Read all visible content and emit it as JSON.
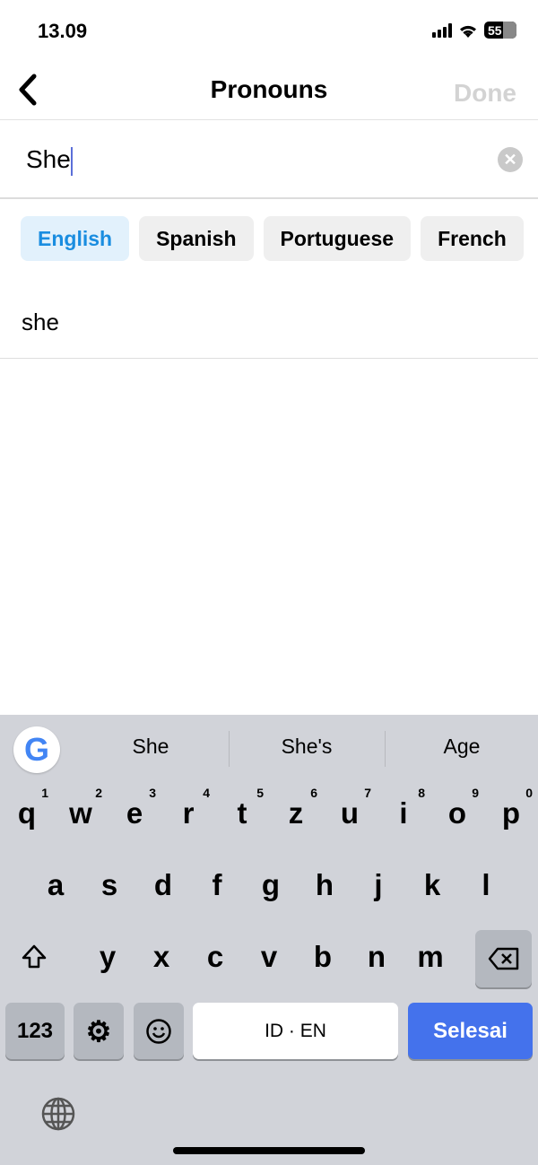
{
  "status": {
    "time": "13.09",
    "battery": "55"
  },
  "nav": {
    "title": "Pronouns",
    "done_label": "Done"
  },
  "search": {
    "value": "She"
  },
  "chips": [
    {
      "label": "English",
      "active": true
    },
    {
      "label": "Spanish"
    },
    {
      "label": "Portuguese"
    },
    {
      "label": "French"
    }
  ],
  "results": [
    "she"
  ],
  "keyboard": {
    "suggestions": [
      "She",
      "She's",
      "Age"
    ],
    "row1": [
      [
        "q",
        "1"
      ],
      [
        "w",
        "2"
      ],
      [
        "e",
        "3"
      ],
      [
        "r",
        "4"
      ],
      [
        "t",
        "5"
      ],
      [
        "z",
        "6"
      ],
      [
        "u",
        "7"
      ],
      [
        "i",
        "8"
      ],
      [
        "o",
        "9"
      ],
      [
        "p",
        "0"
      ]
    ],
    "row2": [
      "a",
      "s",
      "d",
      "f",
      "g",
      "h",
      "j",
      "k",
      "l"
    ],
    "row3": [
      "y",
      "x",
      "c",
      "v",
      "b",
      "n",
      "m"
    ],
    "numbers_label": "123",
    "space_label": "ID · EN",
    "enter_label": "Selesai",
    "accent": "#4472ec"
  }
}
